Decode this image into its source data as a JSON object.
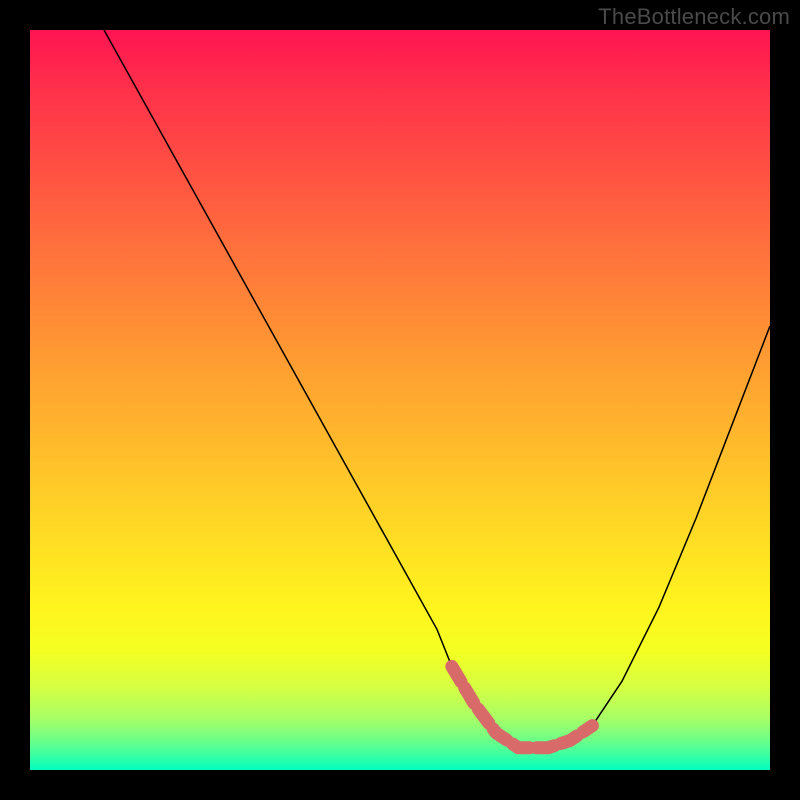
{
  "watermark": "TheBottleneck.com",
  "chart_data": {
    "type": "line",
    "title": "",
    "xlabel": "",
    "ylabel": "",
    "xlim": [
      0,
      100
    ],
    "ylim": [
      0,
      100
    ],
    "legend": false,
    "grid": false,
    "series": [
      {
        "name": "bottleneck-curve",
        "color": "#000000",
        "x": [
          10,
          15,
          20,
          25,
          30,
          35,
          40,
          45,
          50,
          55,
          57,
          60,
          63,
          66,
          68,
          70,
          73,
          76,
          80,
          85,
          90,
          95,
          100
        ],
        "values": [
          100,
          91,
          82,
          73,
          64,
          55,
          46,
          37,
          28,
          19,
          14,
          9,
          5,
          3,
          3,
          3,
          4,
          6,
          12,
          22,
          34,
          47,
          60
        ]
      },
      {
        "name": "optimal-range-highlight",
        "color": "#d86a6a",
        "x": [
          57,
          60,
          63,
          66,
          68,
          70,
          73,
          76
        ],
        "values": [
          14,
          9,
          5,
          3,
          3,
          3,
          4,
          6
        ]
      }
    ],
    "background_gradient": {
      "top": "#ff1452",
      "mid": "#ffe023",
      "bottom": "#00ffc0"
    }
  }
}
